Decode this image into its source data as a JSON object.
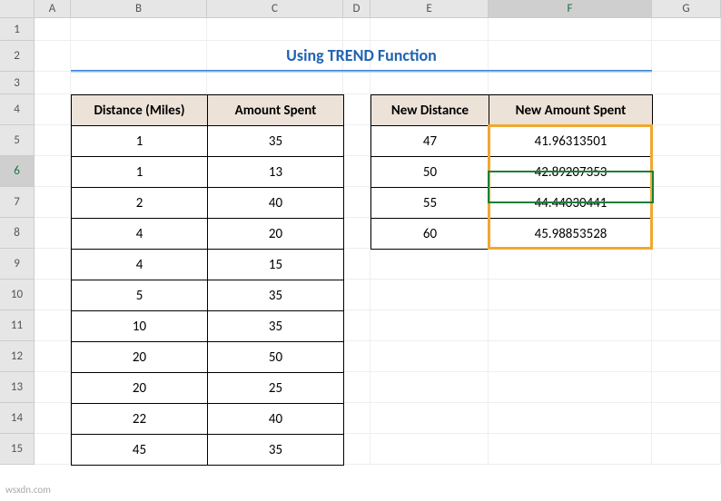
{
  "columns": [
    "A",
    "B",
    "C",
    "D",
    "E",
    "F",
    "G"
  ],
  "rows": [
    "1",
    "2",
    "3",
    "4",
    "5",
    "6",
    "7",
    "8",
    "9",
    "10",
    "11",
    "12",
    "13",
    "14",
    "15"
  ],
  "active_column": "F",
  "active_row": "6",
  "title": "Using TREND Function",
  "table1": {
    "headers": [
      "Distance (Miles)",
      "Amount Spent"
    ],
    "rows": [
      [
        "1",
        "35"
      ],
      [
        "1",
        "13"
      ],
      [
        "2",
        "40"
      ],
      [
        "4",
        "20"
      ],
      [
        "4",
        "15"
      ],
      [
        "5",
        "35"
      ],
      [
        "10",
        "35"
      ],
      [
        "20",
        "50"
      ],
      [
        "20",
        "25"
      ],
      [
        "22",
        "40"
      ],
      [
        "45",
        "35"
      ]
    ]
  },
  "table2": {
    "headers": [
      "New Distance",
      "New Amount Spent"
    ],
    "rows": [
      [
        "47",
        "41.96313501"
      ],
      [
        "50",
        "42.89207353"
      ],
      [
        "55",
        "44.44030441"
      ],
      [
        "60",
        "45.98853528"
      ]
    ]
  },
  "watermark": "wsxdn.com"
}
